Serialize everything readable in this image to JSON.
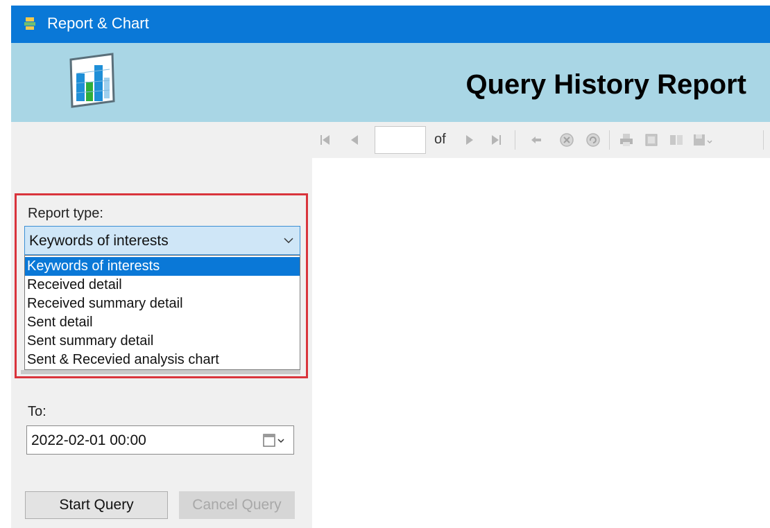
{
  "window": {
    "title": "Report & Chart",
    "icon": "app-icon"
  },
  "header": {
    "report_title": "Query History Report",
    "logo": "chart-logo-icon"
  },
  "toolbar": {
    "page_value": "",
    "of_label": "of",
    "buttons": [
      "first-page-icon",
      "prev-page-icon",
      "next-page-icon",
      "last-page-icon",
      "back-icon",
      "stop-icon",
      "refresh-icon",
      "print-icon",
      "page-setup-icon",
      "layout-icon",
      "save-icon"
    ]
  },
  "report_type": {
    "label": "Report type:",
    "selected": "Keywords of interests",
    "options": [
      "Keywords of interests",
      "Received detail",
      "Received summary detail",
      "Sent detail",
      "Sent summary detail",
      "Sent & Recevied analysis chart"
    ]
  },
  "to": {
    "label": "To:",
    "value": "2022-02-01 00:00"
  },
  "buttons": {
    "start": "Start Query",
    "cancel": "Cancel Query"
  },
  "colors": {
    "titlebar": "#0a78d7",
    "header": "#a9d6e5",
    "highlight": "#d9343c",
    "selection": "#0a78d7"
  }
}
